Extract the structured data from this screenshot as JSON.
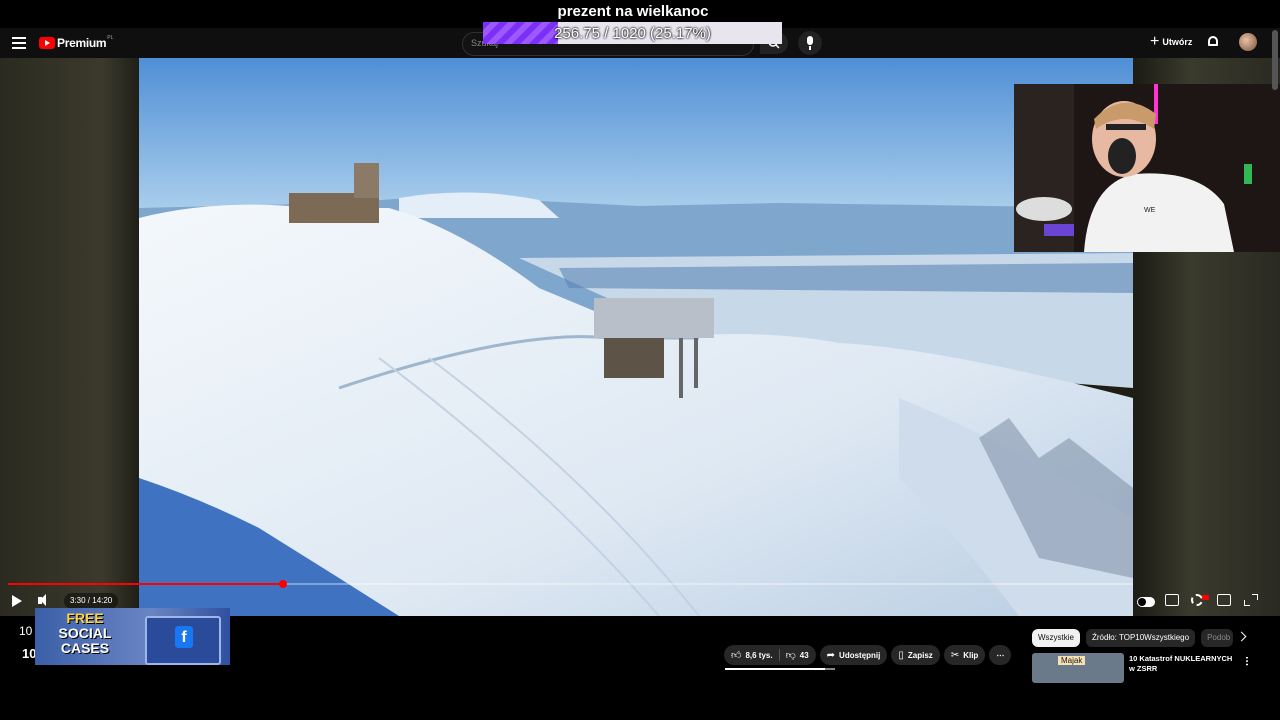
{
  "donation": {
    "title": "prezent na wielkanoc",
    "progress_text": "256.75 / 1020 (25.17%)",
    "progress_fraction": 0.2517
  },
  "header": {
    "brand": "Premium",
    "brand_region": "PL",
    "search_placeholder": "Szukaj",
    "create_label": "Utwórz"
  },
  "player": {
    "time": "3:30 / 14:20",
    "progress_fraction": 0.2442
  },
  "channel": {
    "sub_count_top": "10",
    "sub_count_bottom": "10"
  },
  "ad": {
    "line1": "FREE",
    "line2": "SOCIAL",
    "line3": "CASES",
    "fb": "f"
  },
  "actions": {
    "likes": "8,6 tys.",
    "dislikes": "43",
    "share": "Udostępnij",
    "save": "Zapisz",
    "clip": "Klip",
    "more": "⋯"
  },
  "sidebar": {
    "chips": [
      "Wszystkie",
      "Źródło: TOP10Wszystkiego",
      "Podob"
    ],
    "recommendation": {
      "tag": "Majak",
      "title": "10 Katastrof NUKLEARNYCH w ZSRR"
    }
  },
  "colors": {
    "accent": "#ff0000",
    "donation_fill": "#7b2ff7"
  }
}
